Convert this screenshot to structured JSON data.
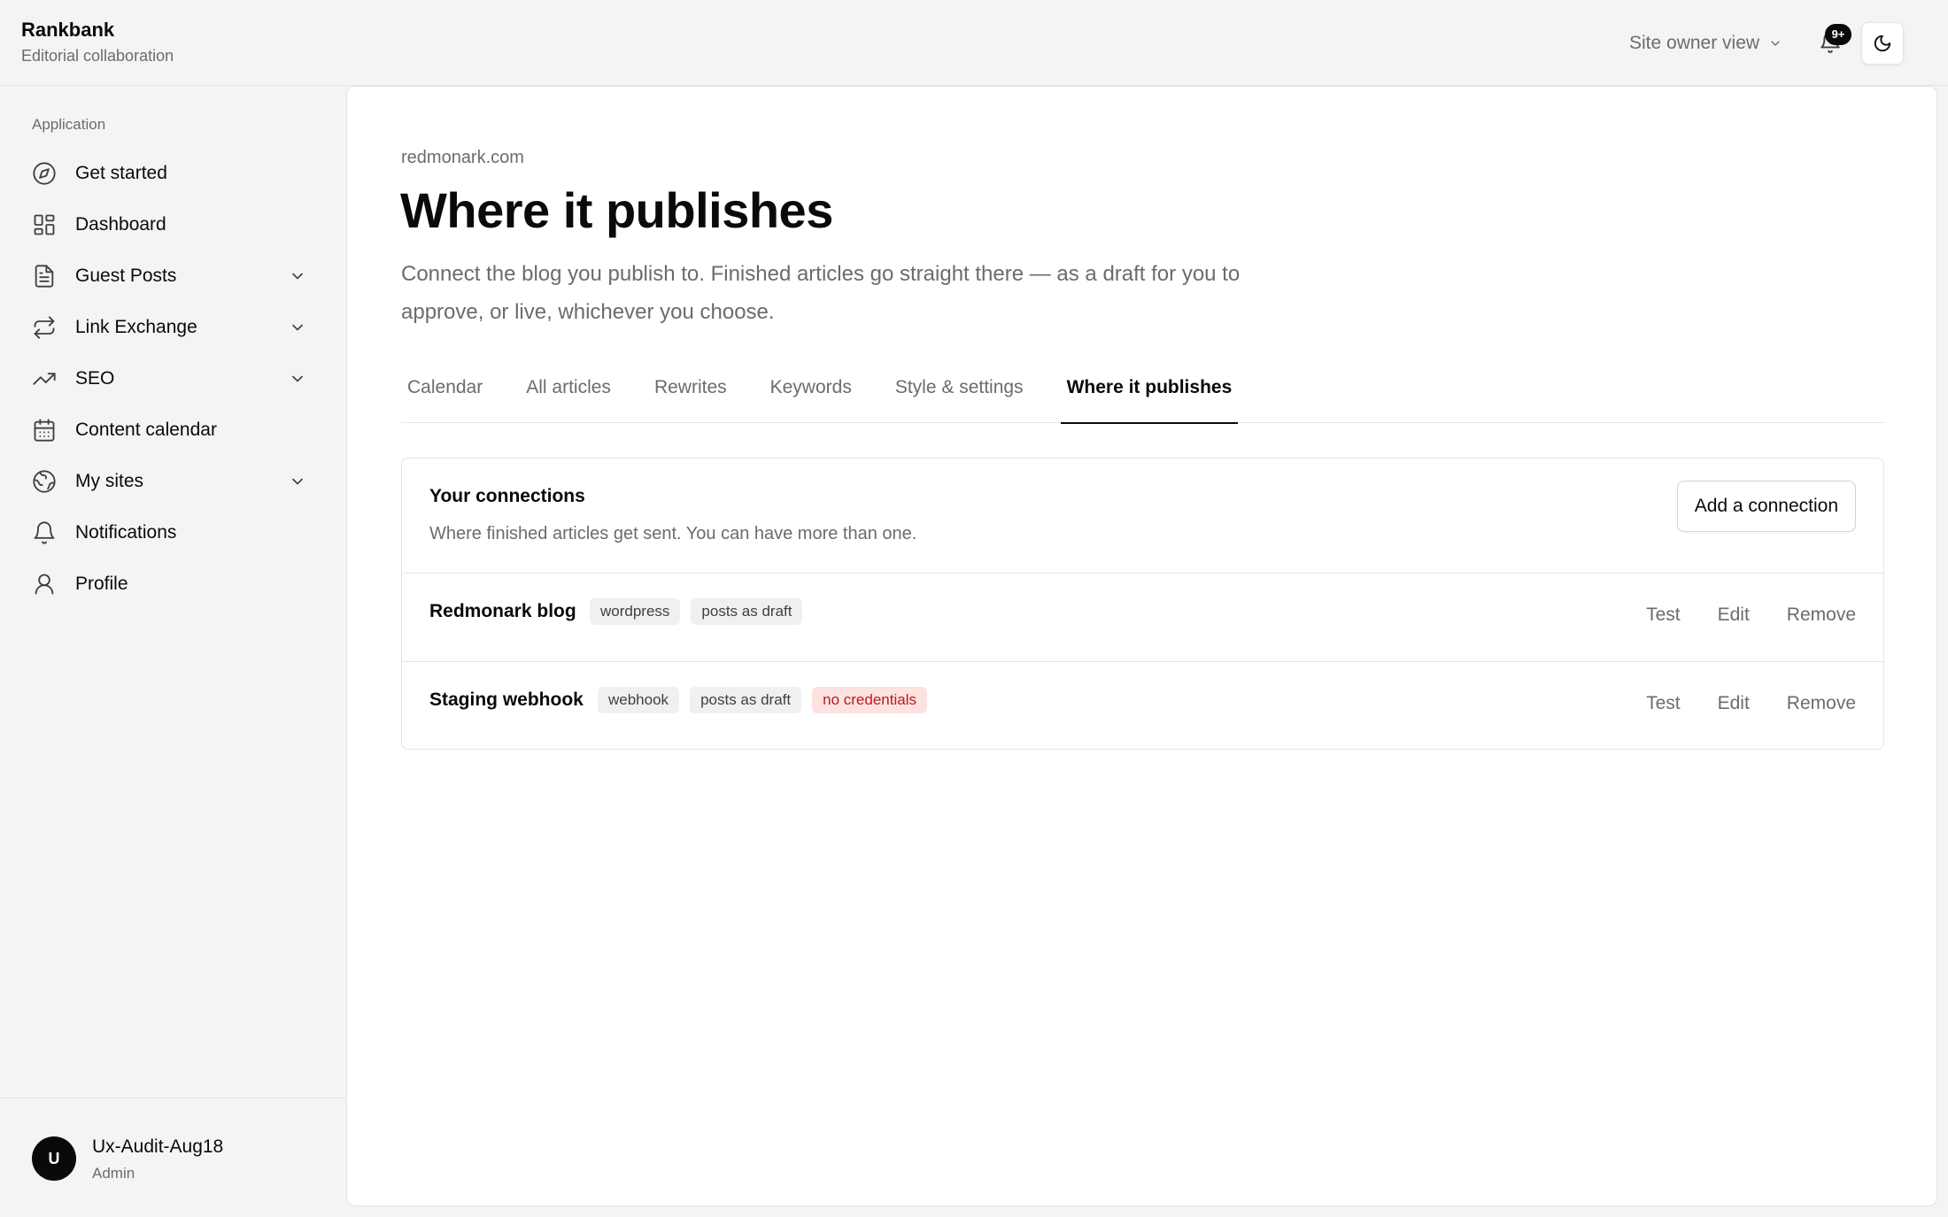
{
  "app": {
    "name": "Rankbank",
    "subtitle": "Editorial collaboration"
  },
  "header": {
    "view_switch": "Site owner view",
    "notification_count": "9+",
    "icons": [
      "chevron-down-icon",
      "bell-icon",
      "moon-icon"
    ]
  },
  "sidebar": {
    "section_label": "Application",
    "items": [
      {
        "label": "Get started",
        "icon": "compass-icon"
      },
      {
        "label": "Dashboard",
        "icon": "layout-grid-icon"
      },
      {
        "label": "Guest Posts",
        "icon": "document-icon"
      },
      {
        "label": "Link Exchange",
        "icon": "repeat-icon"
      },
      {
        "label": "SEO",
        "icon": "trending-up-icon"
      },
      {
        "label": "Content calendar",
        "icon": "calendar-icon"
      },
      {
        "label": "My sites",
        "icon": "globe-icon"
      },
      {
        "label": "Notifications",
        "icon": "bell-icon"
      },
      {
        "label": "Profile",
        "icon": "user-icon"
      }
    ],
    "user": {
      "initial": "U",
      "name": "Ux-Audit-Aug18",
      "role": "Admin"
    }
  },
  "main": {
    "breadcrumb": "redmonark.com",
    "title": "Where it publishes",
    "description": "Connect the blog you publish to. Finished articles go straight there — as a draft for you to approve, or live, whichever you choose.",
    "tabs": [
      {
        "label": "Calendar"
      },
      {
        "label": "All articles"
      },
      {
        "label": "Rewrites"
      },
      {
        "label": "Keywords"
      },
      {
        "label": "Style & settings"
      },
      {
        "label": "Where it publishes"
      }
    ],
    "active_tab": "Where it publishes",
    "connections": {
      "title": "Your connections",
      "subtitle": "Where finished articles get sent. You can have more than one.",
      "add_button": "Add a connection",
      "items": [
        {
          "name": "Redmonark blog",
          "tags": [
            "wordpress",
            "posts as draft"
          ],
          "warning": ""
        },
        {
          "name": "Staging webhook",
          "tags": [
            "webhook",
            "posts as draft"
          ],
          "warning": "no credentials"
        }
      ],
      "actions": {
        "test": "Test",
        "edit": "Edit",
        "remove": "Remove"
      }
    }
  },
  "colors": {
    "text": "#0a0a0a",
    "muted": "#6b6b70",
    "warning_bg": "#fde2e2",
    "warning_text": "#b91c1c",
    "sidebar_bg": "#f4f4f5"
  }
}
